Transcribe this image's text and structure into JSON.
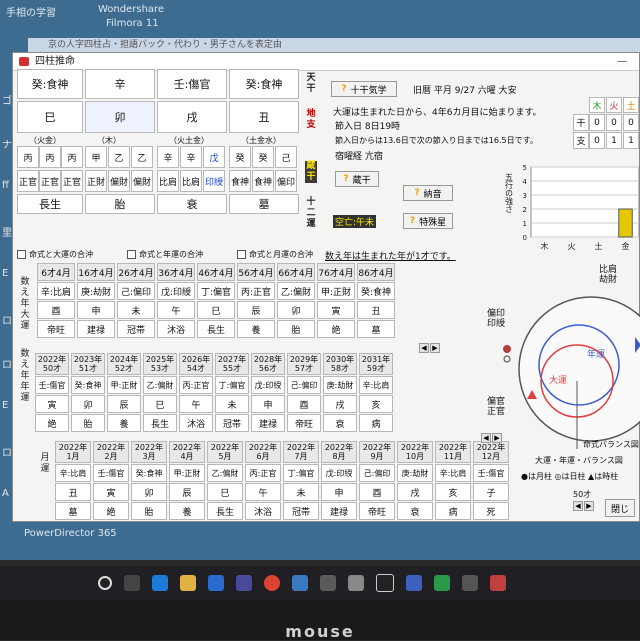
{
  "desktop": {
    "top_left_icon": "手相の学習",
    "top_app_1": "Wondershare",
    "top_app_2": "Filmora 11",
    "bottom_app": "PowerDirector 365",
    "left_labels": [
      "ゴ",
      "ナ",
      "ff",
      "里",
      "E",
      "ロ",
      "ロ",
      "E",
      "ロ",
      "A"
    ],
    "brand": "mouse"
  },
  "background_window": {
    "title": "京の人字四柱占・担語パック・代わり・男子さんを表定由"
  },
  "window": {
    "title": "四柱推命",
    "min": "—"
  },
  "pillars": {
    "stem_tsuhen": [
      "癸:食神",
      "辛",
      "壬:傷官",
      "癸:食神"
    ],
    "branches": [
      "巳",
      "卯",
      "戌",
      "丑"
    ],
    "elements": [
      "（火金）",
      "（木）",
      "（火土金）",
      "（土金水）"
    ],
    "zokan": [
      "丙",
      "丙",
      "丙",
      "甲",
      "乙",
      "乙",
      "辛",
      "辛",
      "戊",
      "癸",
      "癸",
      "己"
    ],
    "zokan_tsuhen": [
      "正官",
      "正官",
      "正官",
      "正財",
      "偏財",
      "偏財",
      "比肩",
      "比肩",
      "印綬",
      "食神",
      "食神",
      "偏印"
    ],
    "junishi": [
      "長生",
      "胎",
      "衰",
      "墓"
    ],
    "side": {
      "tenkan": "天干",
      "chishi": "地支",
      "zokan": "蔵干",
      "junun": "十二運"
    }
  },
  "info": {
    "jikkan_btn": "十干気学",
    "calendar": "旧暦  平月 9/27  六曜 大安",
    "taiun_start": "大運は生まれた日から、4年6カ月目に始まります。",
    "setsuiri": "節入日  8日19時",
    "setsuiri_note": "節入日からは13.6日で次の節入り日までは16.5日です。",
    "shukuyo": "宿曜経  亢宿",
    "uzo_btn": "蔵干",
    "nattin_btn": "納音",
    "kuubou": "空亡:午未",
    "tokushu_btn": "特殊星",
    "kazoe_note": "数え年は生まれた年が1才です。",
    "qmark": "?"
  },
  "checks": [
    "命式と大運の合沖",
    "命式と年運の合沖",
    "命式と月運の合沖"
  ],
  "taiun": {
    "section_label": "数え年大運",
    "ages": [
      "6才4月",
      "16才4月",
      "26才4月",
      "36才4月",
      "46才4月",
      "56才4月",
      "66才4月",
      "76才4月",
      "86才4月"
    ],
    "tsuhen": [
      "辛:比肩",
      "庚:劫財",
      "己:偏印",
      "戊:印綬",
      "丁:偏官",
      "丙:正官",
      "乙:偏財",
      "甲:正財",
      "癸:食神"
    ],
    "shi": [
      "酉",
      "申",
      "未",
      "午",
      "巳",
      "辰",
      "卯",
      "寅",
      "丑"
    ],
    "unsei": [
      "帝旺",
      "建禄",
      "冠帯",
      "沐浴",
      "長生",
      "養",
      "胎",
      "絶",
      "墓"
    ]
  },
  "nenun": {
    "section_label": "数え年年運",
    "years": [
      "2022年",
      "2023年",
      "2024年",
      "2025年",
      "2026年",
      "2027年",
      "2028年",
      "2029年",
      "2030年",
      "2031年"
    ],
    "ages": [
      "50才",
      "51才",
      "52才",
      "53才",
      "54才",
      "55才",
      "56才",
      "57才",
      "58才",
      "59才"
    ],
    "tsuhen": [
      "壬:傷官",
      "癸:食神",
      "甲:正財",
      "乙:偏財",
      "丙:正官",
      "丁:偏官",
      "戊:印綬",
      "己:偏印",
      "庚:劫財",
      "辛:比肩"
    ],
    "shi": [
      "寅",
      "卯",
      "辰",
      "巳",
      "午",
      "未",
      "申",
      "酉",
      "戌",
      "亥"
    ],
    "unsei": [
      "絶",
      "胎",
      "養",
      "長生",
      "沐浴",
      "冠帯",
      "建禄",
      "帝旺",
      "衰",
      "病"
    ]
  },
  "getsuun": {
    "section_label": "月運",
    "months": [
      "2022年\n1月",
      "2022年\n2月",
      "2022年\n3月",
      "2022年\n4月",
      "2022年\n5月",
      "2022年\n6月",
      "2022年\n7月",
      "2022年\n8月",
      "2022年\n9月",
      "2022年\n10月",
      "2022年\n11月",
      "2022年\n12月"
    ],
    "tsuhen": [
      "辛:比肩",
      "壬:傷官",
      "癸:食神",
      "甲:正財",
      "乙:偏財",
      "丙:正官",
      "丁:偏官",
      "戊:印綬",
      "己:偏印",
      "庚:劫財",
      "辛:比肩",
      "壬:傷官"
    ],
    "shi": [
      "丑",
      "寅",
      "卯",
      "辰",
      "巳",
      "午",
      "未",
      "申",
      "酉",
      "戌",
      "亥",
      "子"
    ],
    "unsei": [
      "墓",
      "絶",
      "胎",
      "養",
      "長生",
      "沐浴",
      "冠帯",
      "建禄",
      "帝旺",
      "衰",
      "病",
      "死"
    ]
  },
  "gogyo_table": {
    "headers": [
      "木",
      "火",
      "土"
    ],
    "header_colors": [
      "#2a9a2a",
      "#e02020",
      "#c88a00"
    ],
    "rows": [
      {
        "label": "干",
        "values": [
          "0",
          "0",
          "0"
        ]
      },
      {
        "label": "支",
        "values": [
          "0",
          "1",
          "1"
        ]
      }
    ]
  },
  "chart_data": {
    "type": "bar",
    "ylabel": "五行の強さ",
    "categories": [
      "木",
      "火",
      "土",
      "金"
    ],
    "values": [
      0,
      0,
      0,
      2
    ],
    "ylim": [
      0,
      5
    ],
    "yticks": [
      "5",
      "4",
      "3",
      "2",
      "1",
      "0"
    ],
    "grid": true,
    "bar_color": "#e6c800"
  },
  "circle": {
    "labels": {
      "hikenkoukai": "比肩\n劫財",
      "henin": "偏印\n印綬",
      "henkan": "偏官\n正官",
      "nenun": "年運",
      "taiun": "大運",
      "meishiki": "命式バランス図",
      "balance": "大運・年運・バランス図"
    },
    "legend": "●は月柱  ◎は日柱  ▲は時柱",
    "scale_label": "50才",
    "close_btn": "閉じ"
  }
}
